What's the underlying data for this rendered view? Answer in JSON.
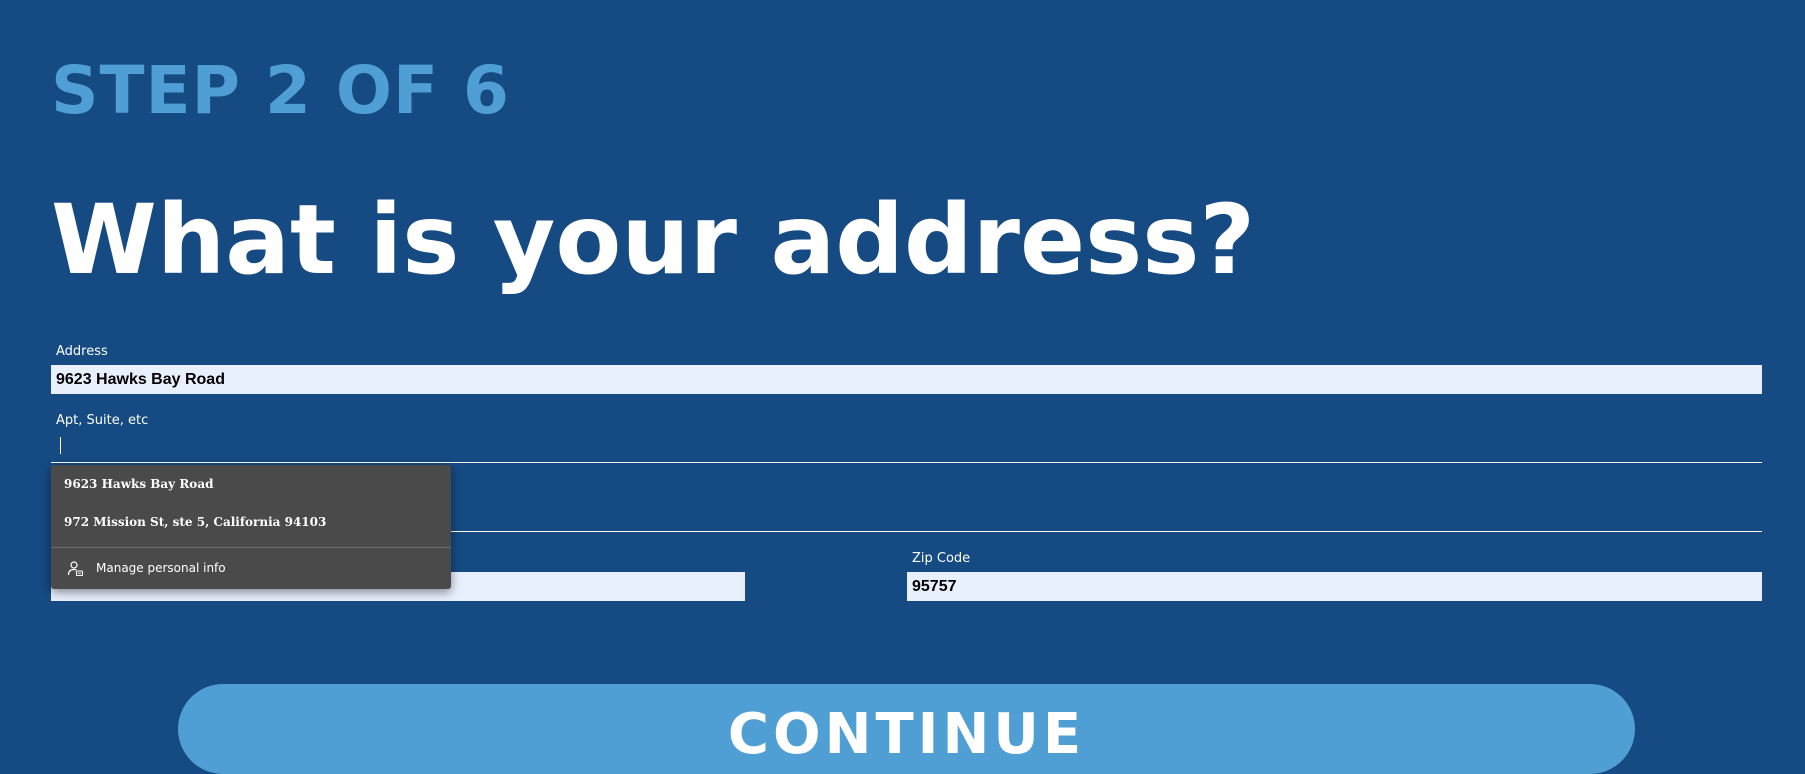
{
  "header": {
    "step": "STEP 2 OF 6",
    "question": "What is your address?"
  },
  "form": {
    "address": {
      "label": "Address",
      "value": "9623 Hawks Bay Road"
    },
    "apt": {
      "label": "Apt, Suite, etc",
      "value": ""
    },
    "city": {
      "value": ""
    },
    "state": {
      "value": ""
    },
    "zip": {
      "label": "Zip Code",
      "value": "95757"
    }
  },
  "autofill": {
    "suggestions": [
      "9623 Hawks Bay Road",
      "972 Mission St, ste 5, California 94103"
    ],
    "manage_label": "Manage personal info",
    "manage_icon": "person-card-icon"
  },
  "actions": {
    "continue_label": "CONTINUE"
  },
  "colors": {
    "background": "#154a83",
    "accent": "#4f9fd4",
    "input_fill": "#e8f0fe",
    "dropdown": "#4a4a4a"
  }
}
